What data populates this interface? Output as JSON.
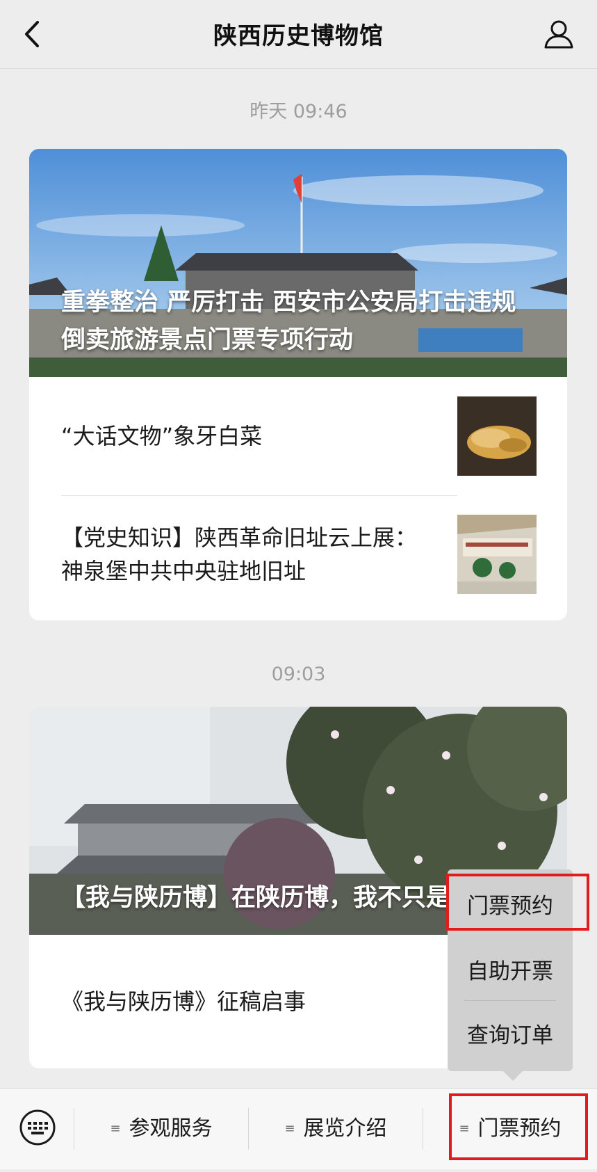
{
  "header": {
    "title": "陕西历史博物馆",
    "back_icon": "chevron-left-icon",
    "profile_icon": "user-icon"
  },
  "messages": [
    {
      "timestamp": "昨天 09:46",
      "hero_title": "重拳整治 严厉打击 西安市公安局打击违规倒卖旅游景点门票专项行动",
      "items": [
        {
          "text": "“大话文物”象牙白菜"
        },
        {
          "text": "【党史知识】陕西革命旧址云上展：神泉堡中共中央驻地旧址"
        }
      ]
    },
    {
      "timestamp": "09:03",
      "hero_title": "【我与陕历博】在陕历博，我不只是志愿者",
      "items": [
        {
          "text": "《我与陕历博》征稿启事"
        }
      ]
    }
  ],
  "popup_menu": {
    "items": [
      "门票预约",
      "自助开票",
      "查询订单"
    ],
    "highlighted_index": 0
  },
  "bottom_menu": {
    "keyboard_icon": "keyboard-icon",
    "items": [
      "参观服务",
      "展览介绍",
      "门票预约"
    ],
    "highlighted_index": 2
  },
  "colors": {
    "background": "#ededed",
    "card": "#ffffff",
    "highlight": "#e21c1c",
    "popup": "#d0d0d0",
    "timestamp": "#9e9e9e"
  }
}
